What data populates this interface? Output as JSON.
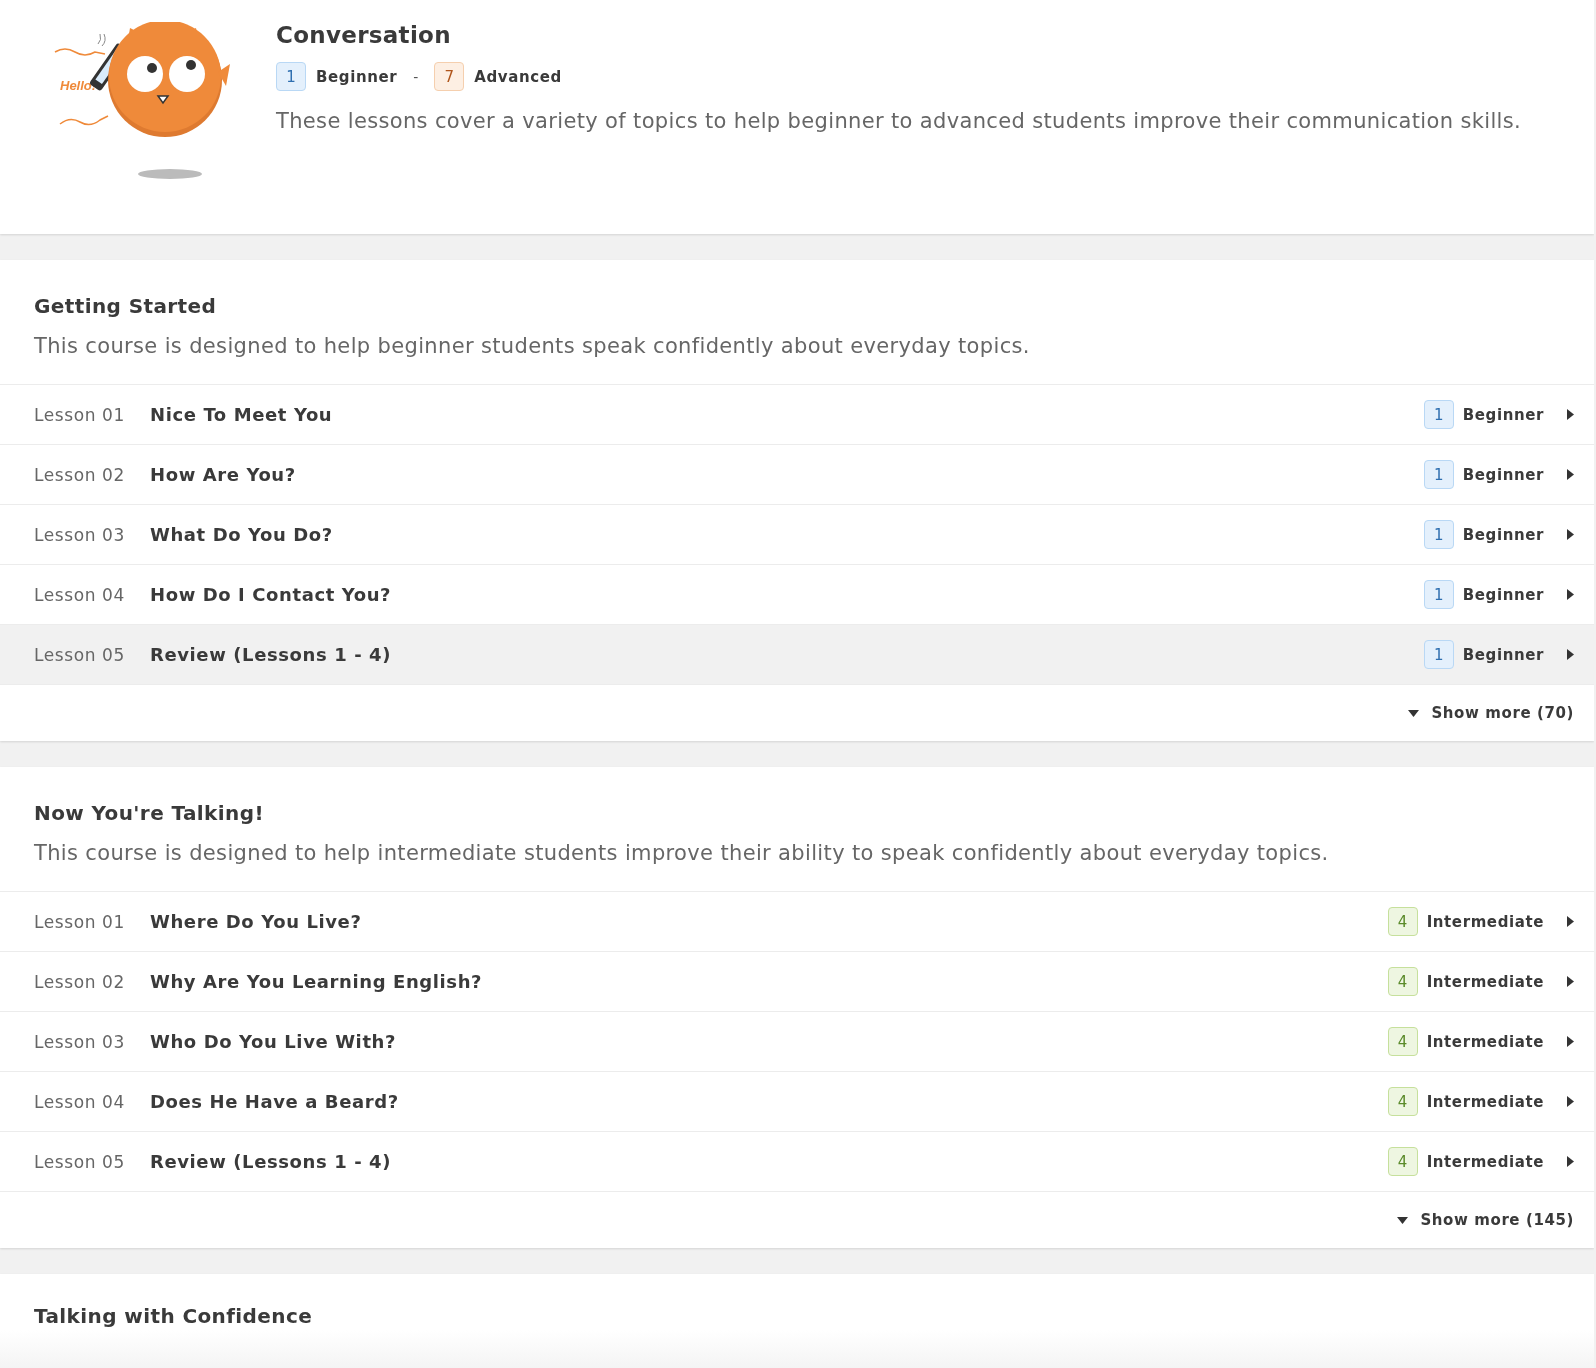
{
  "header": {
    "mascot_caption": "Hello!",
    "title": "Conversation",
    "range": [
      {
        "number": "1",
        "label": "Beginner",
        "kind": "beginner"
      },
      {
        "number": "7",
        "label": "Advanced",
        "kind": "advanced"
      }
    ],
    "range_separator": "-",
    "description": "These lessons cover a variety of topics to help beginner to advanced students improve their communication skills."
  },
  "courses": [
    {
      "title": "Getting Started",
      "description": "This course is designed to help beginner students speak confidently about everyday topics.",
      "lessons": [
        {
          "number": "Lesson 01",
          "title": "Nice To Meet You",
          "level_number": "1",
          "level_label": "Beginner",
          "kind": "beginner",
          "selected": false
        },
        {
          "number": "Lesson 02",
          "title": "How Are You?",
          "level_number": "1",
          "level_label": "Beginner",
          "kind": "beginner",
          "selected": false
        },
        {
          "number": "Lesson 03",
          "title": "What Do You Do?",
          "level_number": "1",
          "level_label": "Beginner",
          "kind": "beginner",
          "selected": false
        },
        {
          "number": "Lesson 04",
          "title": "How Do I Contact You?",
          "level_number": "1",
          "level_label": "Beginner",
          "kind": "beginner",
          "selected": false
        },
        {
          "number": "Lesson 05",
          "title": "Review (Lessons 1 - 4)",
          "level_number": "1",
          "level_label": "Beginner",
          "kind": "beginner",
          "selected": true
        }
      ],
      "show_more": "Show more (70)"
    },
    {
      "title": "Now You're Talking!",
      "description": "This course is designed to help intermediate students improve their ability to speak confidently about everyday topics.",
      "lessons": [
        {
          "number": "Lesson 01",
          "title": "Where Do You Live?",
          "level_number": "4",
          "level_label": "Intermediate",
          "kind": "intermediate",
          "selected": false
        },
        {
          "number": "Lesson 02",
          "title": "Why Are You Learning English?",
          "level_number": "4",
          "level_label": "Intermediate",
          "kind": "intermediate",
          "selected": false
        },
        {
          "number": "Lesson 03",
          "title": "Who Do You Live With?",
          "level_number": "4",
          "level_label": "Intermediate",
          "kind": "intermediate",
          "selected": false
        },
        {
          "number": "Lesson 04",
          "title": "Does He Have a Beard?",
          "level_number": "4",
          "level_label": "Intermediate",
          "kind": "intermediate",
          "selected": false
        },
        {
          "number": "Lesson 05",
          "title": "Review (Lessons 1 - 4)",
          "level_number": "4",
          "level_label": "Intermediate",
          "kind": "intermediate",
          "selected": false
        }
      ],
      "show_more": "Show more (145)"
    },
    {
      "title": "Talking with Confidence"
    }
  ]
}
